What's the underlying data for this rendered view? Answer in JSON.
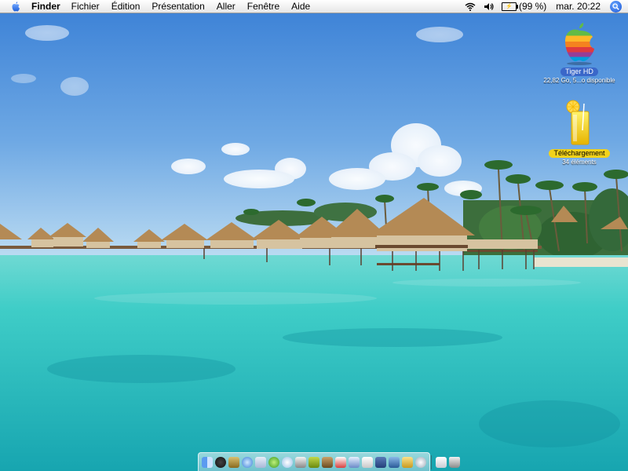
{
  "menubar": {
    "apple_icon": "apple-logo-icon",
    "app_name": "Finder",
    "menus": [
      "Fichier",
      "Édition",
      "Présentation",
      "Aller",
      "Fenêtre",
      "Aide"
    ],
    "status": {
      "wifi_icon": "wifi-icon",
      "volume_icon": "speaker-icon",
      "battery_icon": "battery-icon",
      "battery_text": "(99 %)",
      "clock": "mar. 20:22",
      "spotlight_icon": "spotlight-search-icon"
    }
  },
  "desktop": {
    "icons": [
      {
        "label": "Tiger HD",
        "sublabel": "22,82 Go, 5...o disponible",
        "icon": "hard-drive-apple-icon",
        "label_color": "#3a67c9"
      },
      {
        "label": "Téléchargement",
        "sublabel": "34 éléments",
        "icon": "downloads-folder-drink-icon",
        "label_color": "#f2d21b"
      }
    ]
  },
  "dock": {
    "apps": [
      "finder-icon",
      "dashboard-icon",
      "mail-icon",
      "safari-icon",
      "ical-icon",
      "ichat-icon",
      "itunes-icon",
      "iphoto-icon",
      "imovie-icon",
      "address-book-icon",
      "calendar-icon",
      "preview-icon",
      "textedit-icon",
      "system-preferences-icon",
      "network-icon",
      "terminal-icon",
      "stickies-icon"
    ],
    "others": [
      "downloads-stack-icon",
      "trash-icon"
    ]
  },
  "colors": {
    "sky_top": "#3f86d9",
    "sky_bottom": "#b6d8f2",
    "lagoon": "#3ccdc7",
    "lagoon_deep": "#18a9b3"
  }
}
